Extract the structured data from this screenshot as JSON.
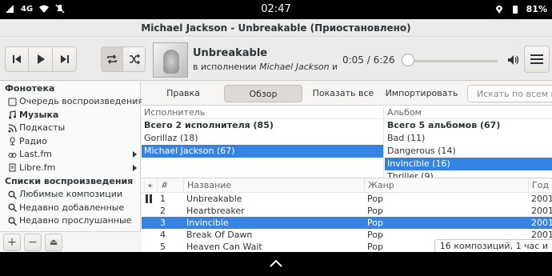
{
  "statusbar": {
    "network": "4G",
    "clock": "02:47",
    "battery": "81%",
    "icons": [
      "signal-icon",
      "wifi-icon",
      "mute-icon",
      "location-icon",
      "battery-icon"
    ]
  },
  "window": {
    "title": "Michael Jackson - Unbreakable (Приостановлено)"
  },
  "player": {
    "track_title": "Unbreakable",
    "track_sub_prefix": "в исполнении ",
    "track_sub_artist": "Michael Jackson",
    "track_sub_suffix": " из ал...",
    "time": "0:05 / 6:26",
    "progress": 0.013
  },
  "sidebar": {
    "section1": "Фонотека",
    "library_items": [
      {
        "label": "Очередь воспроизведения",
        "icon": "queue-icon"
      },
      {
        "label": "Музыка",
        "icon": "music-icon",
        "bold": true
      },
      {
        "label": "Подкасты",
        "icon": "podcast-icon"
      },
      {
        "label": "Радио",
        "icon": "radio-icon"
      },
      {
        "label": "Last.fm",
        "icon": "lastfm-icon",
        "expandable": true
      },
      {
        "label": "Libre.fm",
        "icon": "librefm-icon",
        "expandable": true
      }
    ],
    "section2": "Списки воспроизведения",
    "playlist_items": [
      {
        "label": "Любимые композиции",
        "icon": "search-icon"
      },
      {
        "label": "Недавно добавленные",
        "icon": "search-icon"
      },
      {
        "label": "Недавно прослушанные",
        "icon": "search-icon"
      }
    ],
    "footer": {
      "add": "+",
      "remove": "−",
      "eject": "⏏"
    }
  },
  "tabs": [
    "Правка",
    "Обзор",
    "Показать все",
    "Импортировать"
  ],
  "selected_tab": "Обзор",
  "search": {
    "placeholder": "Искать по всем п"
  },
  "browser": {
    "artist_header": "Исполнитель",
    "artists": [
      "Всего 2 исполнителя (85)",
      "Gorillaz (18)",
      "Michael Jackson (67)"
    ],
    "album_header": "Альбом",
    "albums": [
      "Всего 5 альбомов (67)",
      "Bad (11)",
      "Dangerous (14)",
      "Invincible (16)",
      "Thriller (9)"
    ]
  },
  "tracklist": {
    "headers": {
      "num": "#",
      "title": "Название",
      "genre": "Жанр",
      "year": "Год"
    },
    "rows": [
      {
        "num": "1",
        "title": "Unbreakable",
        "genre": "Pop",
        "year": "2001",
        "playing": true
      },
      {
        "num": "2",
        "title": "Heartbreaker",
        "genre": "Pop",
        "year": "2001"
      },
      {
        "num": "3",
        "title": "Invincible",
        "genre": "Pop",
        "year": "2001",
        "selected": true
      },
      {
        "num": "4",
        "title": "Break Of Dawn",
        "genre": "Pop",
        "year": "2001"
      },
      {
        "num": "5",
        "title": "Heaven Can Wait",
        "genre": "Pop",
        "year": "2001"
      }
    ],
    "status": "16 композиций, 1 час и"
  },
  "colors": {
    "selection": "#3584e4",
    "window_bg": "#f6f5f4"
  }
}
